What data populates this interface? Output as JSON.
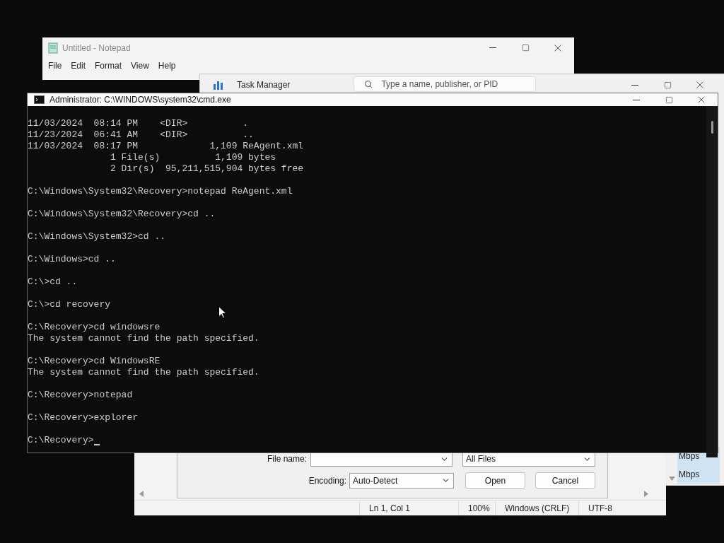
{
  "notepad": {
    "title": "Untitled - Notepad",
    "menu": [
      "File",
      "Edit",
      "Format",
      "View",
      "Help"
    ]
  },
  "task_manager": {
    "title": "Task Manager",
    "search": {
      "placeholder": "Type a name, publisher, or PID"
    },
    "network_cells": [
      "Mbps",
      "Mbps"
    ]
  },
  "cmd": {
    "title": "Administrator: C:\\WINDOWS\\system32\\cmd.exe",
    "blocks": [
      [
        "11/03/2024  08:14 PM    <DIR>          .",
        "11/23/2024  06:41 AM    <DIR>          ..",
        "11/03/2024  08:17 PM             1,109 ReAgent.xml",
        "               1 File(s)          1,109 bytes",
        "               2 Dir(s)  95,211,515,904 bytes free"
      ],
      [
        "C:\\Windows\\System32\\Recovery>notepad ReAgent.xml"
      ],
      [
        "C:\\Windows\\System32\\Recovery>cd .."
      ],
      [
        "C:\\Windows\\System32>cd .."
      ],
      [
        "C:\\Windows>cd .."
      ],
      [
        "C:\\>cd .."
      ],
      [
        "C:\\>cd recovery"
      ],
      [
        "C:\\Recovery>cd windowsre",
        "The system cannot find the path specified."
      ],
      [
        "C:\\Recovery>cd WindowsRE",
        "The system cannot find the path specified."
      ],
      [
        "C:\\Recovery>notepad"
      ],
      [
        "C:\\Recovery>explorer"
      ],
      [
        "C:\\Recovery>"
      ]
    ]
  },
  "open_dialog": {
    "file_name_label": "File name:",
    "file_type": "All Files",
    "encoding_label": "Encoding:",
    "encoding": "Auto-Detect",
    "buttons": [
      "Open",
      "Cancel"
    ]
  },
  "notepad_status_bar": [
    "Ln 1, Col 1",
    "100%",
    "Windows (CRLF)",
    "UTF-8"
  ]
}
